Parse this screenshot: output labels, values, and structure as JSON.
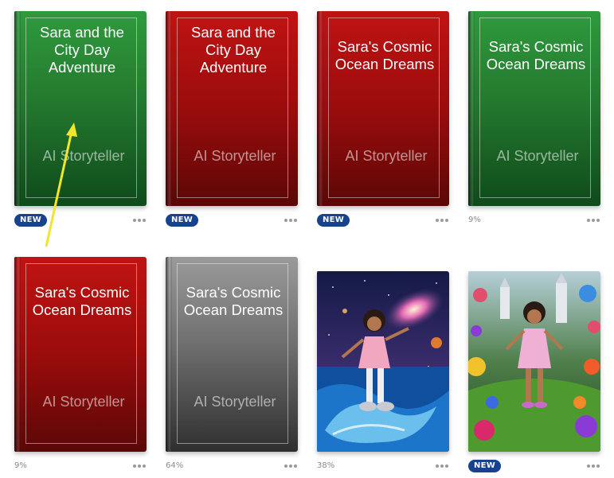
{
  "books": [
    {
      "title": "Sara and the City Day Adventure",
      "author": "AI Storyteller",
      "status": "NEW",
      "color": "#247a2f"
    },
    {
      "title": "Sara and the City Day Adventure",
      "author": "AI Storyteller",
      "status": "NEW",
      "color": "#9b0c0c"
    },
    {
      "title": "Sara's Cosmic Ocean Dreams",
      "author": "AI Storyteller",
      "status": "NEW",
      "color": "#9b0c0c"
    },
    {
      "title": "Sara's Cosmic Ocean Dreams",
      "author": "AI Storyteller",
      "progress": "9%",
      "color": "#247a2f"
    },
    {
      "title": "Sara's Cosmic Ocean Dreams",
      "author": "AI Storyteller",
      "progress": "9%",
      "color": "#9b0c0c"
    },
    {
      "title": "Sara's Cosmic Ocean Dreams",
      "author": "AI Storyteller",
      "progress": "64%",
      "color": "#6f6f6f"
    },
    {
      "illustration": "girl-in-space-ocean-cover",
      "progress": "38%"
    },
    {
      "illustration": "girl-in-flower-garden-cover",
      "status": "NEW"
    }
  ],
  "annotation": {
    "type": "yellow-arrow",
    "color": "#f2e62a"
  }
}
